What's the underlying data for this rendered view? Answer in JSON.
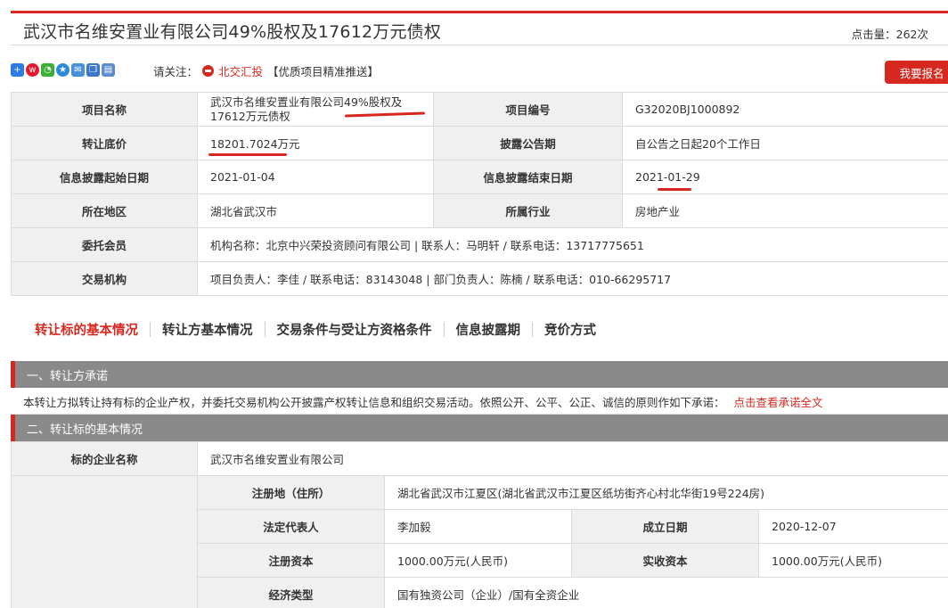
{
  "header": {
    "title": "武汉市名维安置业有限公司49%股权及17612万元债权",
    "hits": "点击量：262次"
  },
  "share": {
    "icons": [
      "plus-share-icon",
      "weibo-icon",
      "wechat-icon",
      "qzone-icon",
      "mail-icon",
      "copy-icon",
      "print-icon"
    ],
    "follow_label": "请关注：",
    "brand_name": "北交汇投",
    "brand_tagline": "【优质项目精准推送】",
    "signup_button": "我要报名"
  },
  "info": {
    "project_name_label": "项目名称",
    "project_name_value": "武汉市名维安置业有限公司49%股权及17612万元债权",
    "project_no_label": "项目编号",
    "project_no_value": "G32020BJ1000892",
    "base_price_label": "转让底价",
    "base_price_value": "18201.7024万元",
    "disclosure_period_label": "披露公告期",
    "disclosure_period_value": "自公告之日起20个工作日",
    "start_date_label": "信息披露起始日期",
    "start_date_value": "2021-01-04",
    "end_date_label": "信息披露结束日期",
    "end_date_value": "2021-01-29",
    "region_label": "所在地区",
    "region_value": "湖北省武汉市",
    "industry_label": "所属行业",
    "industry_value": "房地产业",
    "member_label": "委托会员",
    "member_value": "机构名称：北京中兴荣投资顾问有限公司 | 联系人：马明轩 / 联系电话：13717775651",
    "agency_label": "交易机构",
    "agency_value": "项目负责人：李佳 / 联系电话：83143048 | 部门负责人：陈楠 / 联系电话：010-66295717"
  },
  "tabs": [
    {
      "label": "转让标的基本情况",
      "active": true
    },
    {
      "label": "转让方基本情况",
      "active": false
    },
    {
      "label": "交易条件与受让方资格条件",
      "active": false
    },
    {
      "label": "信息披露期",
      "active": false
    },
    {
      "label": "竞价方式",
      "active": false
    }
  ],
  "section1": {
    "title": "一、转让方承诺",
    "text": "本转让方拟转让持有标的企业产权，并委托交易机构公开披露产权转让信息和组织交易活动。依照公开、公平、公正、诚信的原则作如下承诺：",
    "link": "点击查看承诺全文"
  },
  "section2": {
    "title": "二、转让标的基本情况",
    "target_name_label": "标的企业名称",
    "target_name_value": "武汉市名维安置业有限公司",
    "address_label": "注册地（住所）",
    "address_value": "湖北省武汉市江夏区(湖北省武汉市江夏区纸坊街齐心村北华街19号224房)",
    "legal_rep_label": "法定代表人",
    "legal_rep_value": "李加毅",
    "founded_label": "成立日期",
    "founded_value": "2020-12-07",
    "reg_capital_label": "注册资本",
    "reg_capital_value": "1000.00万元(人民币)",
    "paid_capital_label": "实收资本",
    "paid_capital_value": "1000.00万元(人民币)",
    "econ_type_label": "经济类型",
    "econ_type_value": "国有独资公司（企业）/国有全资企业"
  },
  "colors": {
    "accent": "#d7281f",
    "label_bg": "#f0f0f0",
    "section_bg": "#8a8a8a"
  }
}
